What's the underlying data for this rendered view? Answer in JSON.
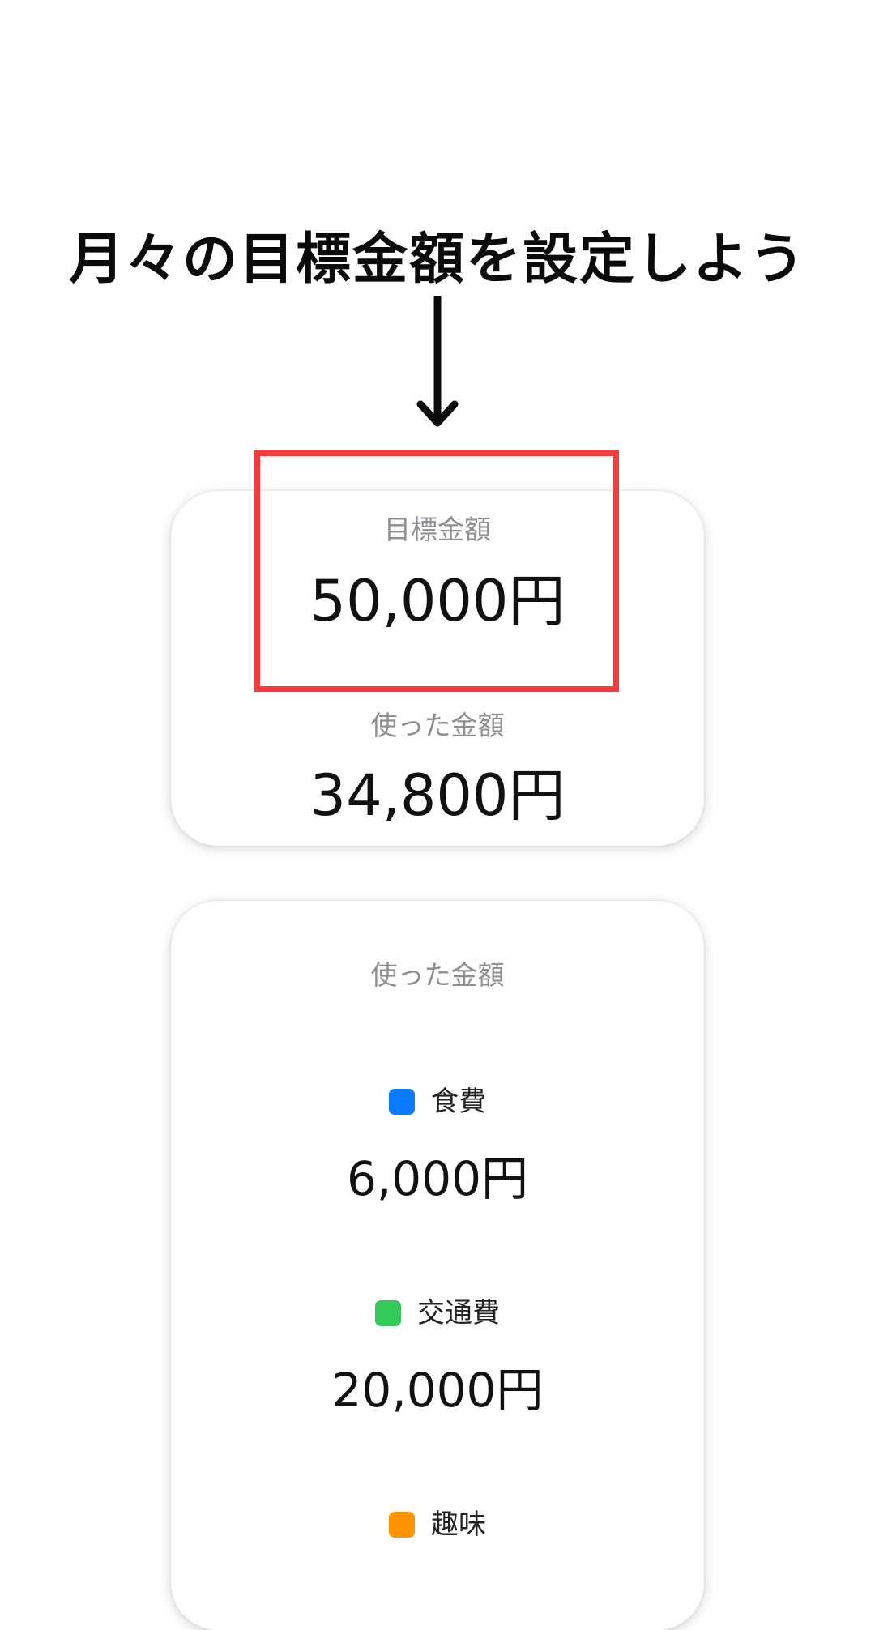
{
  "headline": "月々の目標金額を設定しよう",
  "summary": {
    "target_label": "目標金額",
    "target_amount": "50,000円",
    "spent_label": "使った金額",
    "spent_amount": "34,800円"
  },
  "breakdown": {
    "title": "使った金額",
    "categories": [
      {
        "name": "食費",
        "amount": "6,000円",
        "color": "#0a7aff"
      },
      {
        "name": "交通費",
        "amount": "20,000円",
        "color": "#34c759"
      },
      {
        "name": "趣味",
        "amount": "",
        "color": "#ff9500"
      }
    ]
  },
  "colors": {
    "highlight": "#fa3a3a",
    "label_gray": "#8e8e93"
  },
  "icons": {
    "arrow": "arrow-down-icon"
  }
}
